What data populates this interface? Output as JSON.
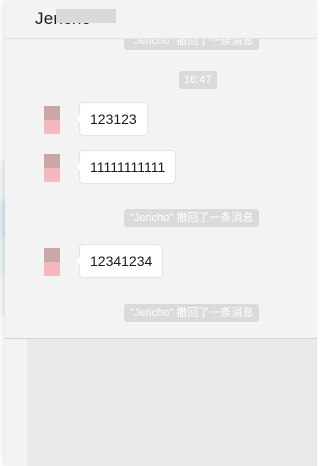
{
  "chat": {
    "contact_name": "Jericho",
    "messages": [
      {
        "type": "system",
        "text": "\"Jericho\" 撤回了一条消息",
        "partial": true
      },
      {
        "type": "time",
        "text": "16:47"
      },
      {
        "type": "text",
        "sender": "contact",
        "text": "123123"
      },
      {
        "type": "text",
        "sender": "contact",
        "text": "11111111111"
      },
      {
        "type": "system",
        "text": "\"Jericho\" 撤回了一条消息"
      },
      {
        "type": "text",
        "sender": "contact",
        "text": "12341234"
      },
      {
        "type": "system",
        "text": "\"Jericho\" 撤回了一条消息"
      }
    ]
  },
  "colors": {
    "window_bg": "#f3f3f3",
    "bubble_bg": "#ffffff",
    "system_chip_bg": "#dadada",
    "compose_bg": "#e9e9e9",
    "avatar_top": "#c9a6a8",
    "avatar_bottom": "#f4b9bf"
  }
}
